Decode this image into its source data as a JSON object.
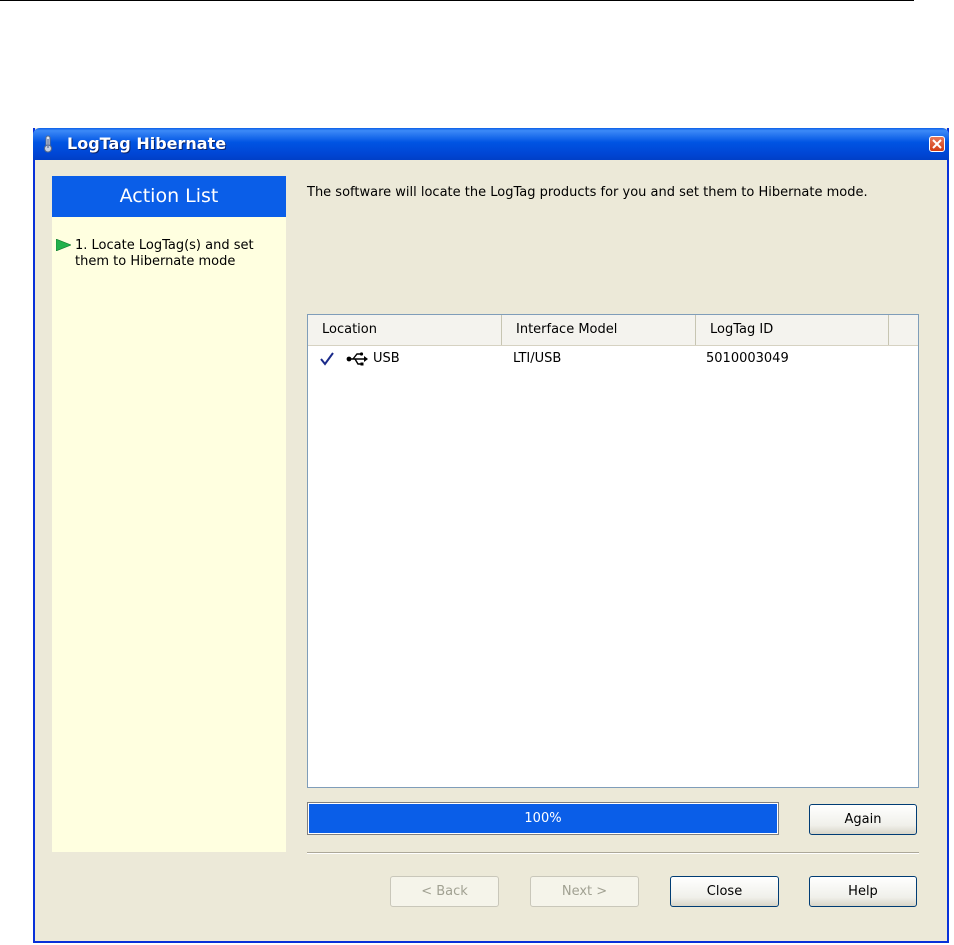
{
  "window": {
    "title": "LogTag Hibernate"
  },
  "sidebar": {
    "header": "Action List",
    "items": [
      {
        "label": "1. Locate LogTag(s) and set them to Hibernate mode"
      }
    ]
  },
  "main": {
    "description": "The software will locate the LogTag products for you and set them to Hibernate mode.",
    "table": {
      "columns": [
        "Location",
        "Interface Model",
        "LogTag ID"
      ],
      "rows": [
        {
          "status_icon": "check-icon",
          "location_icon": "usb-icon",
          "location": "USB",
          "interface_model": "LTI/USB",
          "logtag_id": "5010003049"
        }
      ]
    },
    "progress": {
      "value": 1.0,
      "label": "100%"
    }
  },
  "buttons": {
    "again": "Again",
    "back": "< Back",
    "next": "Next >",
    "close": "Close",
    "help": "Help"
  },
  "colors": {
    "titlebar": "#0054e3",
    "sidebar_header": "#0a5ee8",
    "sidebar_bg": "#ffffe0",
    "progress_fill": "#0a5ee8"
  }
}
